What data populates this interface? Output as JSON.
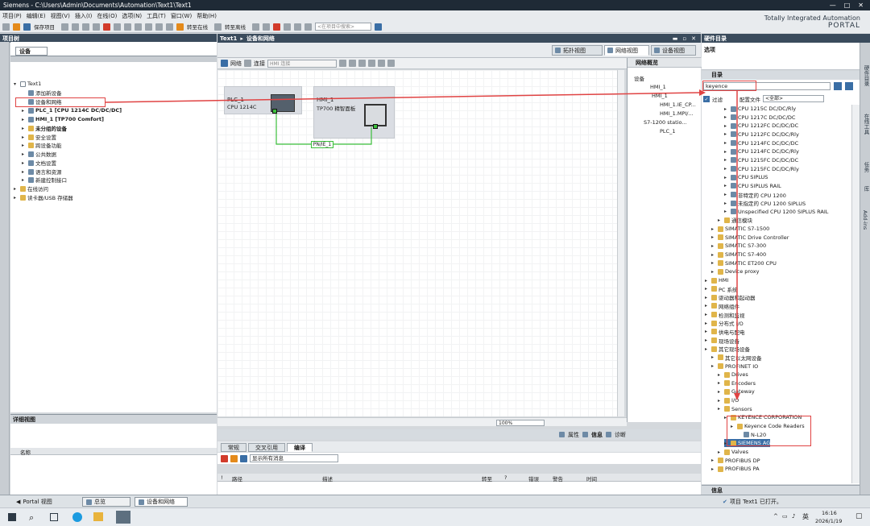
{
  "window": {
    "title": "Siemens - C:\\Users\\Admin\\Documents\\Automation\\Text1\\Text1",
    "controls": [
      "—",
      "□",
      "✕"
    ]
  },
  "menu": [
    "项目(P)",
    "编辑(E)",
    "视图(V)",
    "插入(I)",
    "在线(O)",
    "选项(N)",
    "工具(T)",
    "窗口(W)",
    "帮助(H)"
  ],
  "toolbar": {
    "save_project": "保存项目",
    "go_online": "转至在线",
    "go_offline": "转至离线",
    "search_placeholder": "<在项目中搜索>"
  },
  "brand": {
    "line1": "Totally Integrated Automation",
    "line2": "PORTAL"
  },
  "project_tree": {
    "header": "项目树",
    "devices_tab": "设备",
    "items": [
      {
        "label": "Text1",
        "level": 0,
        "bold": false
      },
      {
        "label": "添加新设备",
        "level": 1,
        "bold": false
      },
      {
        "label": "设备和网络",
        "level": 1,
        "bold": false
      },
      {
        "label": "PLC_1 [CPU 1214C DC/DC/DC]",
        "level": 1,
        "bold": true
      },
      {
        "label": "HMI_1 [TP700 Comfort]",
        "level": 1,
        "bold": true
      },
      {
        "label": "未分组的设备",
        "level": 1,
        "bold": true
      },
      {
        "label": "安全设置",
        "level": 1,
        "bold": false
      },
      {
        "label": "跨设备功能",
        "level": 1,
        "bold": false
      },
      {
        "label": "公共数据",
        "level": 1,
        "bold": false
      },
      {
        "label": "文档设置",
        "level": 1,
        "bold": false
      },
      {
        "label": "语言和资源",
        "level": 1,
        "bold": false
      },
      {
        "label": "新建控制接口",
        "level": 1,
        "bold": false
      },
      {
        "label": "在线访问",
        "level": 0,
        "bold": false
      },
      {
        "label": "读卡器/USB 存储器",
        "level": 0,
        "bold": false
      }
    ]
  },
  "detail_view": {
    "header": "详细视图",
    "col_name": "名称"
  },
  "editor": {
    "breadcrumb": [
      "Text1",
      "设备和网络"
    ],
    "view_tabs": [
      "拓扑视图",
      "网络视图",
      "设备视图"
    ],
    "net_toolbar": {
      "network": "网络",
      "connect": "连接",
      "hmi_conn": "HMI 连接"
    },
    "devices": [
      {
        "name": "PLC_1",
        "type": "CPU 1214C"
      },
      {
        "name": "HMI_1",
        "type": "TP700 精智面板"
      }
    ],
    "network_label": "PN/IE_1",
    "zoom": "100%"
  },
  "overview": {
    "title": "网络概览",
    "rows": [
      "设备",
      "HMI_1",
      "HMI_1",
      "HMI_1.IE_CP...",
      "HMI_1.MPI/...",
      "S7-1200 statio...",
      "PLC_1"
    ]
  },
  "inspector": {
    "props": "属性",
    "info": "信息",
    "diag": "诊断"
  },
  "messages": {
    "tabs": [
      "常规",
      "交叉引用",
      "编译"
    ],
    "filter": "显示所有消息",
    "columns": [
      "!",
      "路径",
      "描述",
      "转至",
      "?",
      "错误",
      "警告",
      "时间"
    ]
  },
  "hw_catalog": {
    "header": "硬件目录",
    "options": "选项",
    "catalog": "目录",
    "search_value": "keyence",
    "filter_label": "过滤",
    "profile_label": "配置文件",
    "profile_value": "<全部>",
    "tree": [
      {
        "label": "CPU 1215C DC/DC/Rly",
        "level": 3
      },
      {
        "label": "CPU 1217C DC/DC/DC",
        "level": 3
      },
      {
        "label": "CPU 1212FC DC/DC/DC",
        "level": 3
      },
      {
        "label": "CPU 1212FC DC/DC/Rly",
        "level": 3
      },
      {
        "label": "CPU 1214FC DC/DC/DC",
        "level": 3
      },
      {
        "label": "CPU 1214FC DC/DC/Rly",
        "level": 3
      },
      {
        "label": "CPU 1215FC DC/DC/DC",
        "level": 3
      },
      {
        "label": "CPU 1215FC DC/DC/Rly",
        "level": 3
      },
      {
        "label": "CPU SIPLUS",
        "level": 3
      },
      {
        "label": "CPU SIPLUS RAIL",
        "level": 3
      },
      {
        "label": "非特定的 CPU 1200",
        "level": 3
      },
      {
        "label": "未指定的 CPU 1200 SIPLUS",
        "level": 3
      },
      {
        "label": "Unspecified CPU 1200 SIPLUS RAIL",
        "level": 3
      },
      {
        "label": "通信模块",
        "level": 2
      },
      {
        "label": "SIMATIC S7-1500",
        "level": 1
      },
      {
        "label": "SIMATIC Drive Controller",
        "level": 1
      },
      {
        "label": "SIMATIC S7-300",
        "level": 1
      },
      {
        "label": "SIMATIC S7-400",
        "level": 1
      },
      {
        "label": "SIMATIC ET200 CPU",
        "level": 1
      },
      {
        "label": "Device proxy",
        "level": 1
      },
      {
        "label": "HMI",
        "level": 0
      },
      {
        "label": "PC 系统",
        "level": 0
      },
      {
        "label": "驱动器和起动器",
        "level": 0
      },
      {
        "label": "网络组件",
        "level": 0
      },
      {
        "label": "检测和监视",
        "level": 0
      },
      {
        "label": "分布式 I/O",
        "level": 0
      },
      {
        "label": "供电与配电",
        "level": 0
      },
      {
        "label": "现场设备",
        "level": 0
      },
      {
        "label": "其它现场设备",
        "level": 0
      },
      {
        "label": "其它以太网设备",
        "level": 1
      },
      {
        "label": "PROFINET IO",
        "level": 1
      },
      {
        "label": "Drives",
        "level": 2
      },
      {
        "label": "Encoders",
        "level": 2
      },
      {
        "label": "Gateway",
        "level": 2
      },
      {
        "label": "I/O",
        "level": 2
      },
      {
        "label": "Sensors",
        "level": 2
      },
      {
        "label": "KEYENCE CORPORATION",
        "level": 3
      },
      {
        "label": "Keyence Code Readers",
        "level": 4
      },
      {
        "label": "N-L20",
        "level": 5
      },
      {
        "label": "SIEMENS AG",
        "level": 3
      },
      {
        "label": "Valves",
        "level": 2
      },
      {
        "label": "PROFIBUS DP",
        "level": 1
      },
      {
        "label": "PROFIBUS PA",
        "level": 1
      }
    ],
    "info_header": "信息"
  },
  "right_tabs": [
    "硬件目录",
    "在线工具",
    "任务",
    "库",
    "Add-ins"
  ],
  "portal_bar": {
    "portal_view": "Portal 视图",
    "tasks": [
      "总览",
      "设备和网络"
    ],
    "status": "项目 Text1 已打开。"
  },
  "taskbar": {
    "time": "16:16",
    "date": "2026/1/19",
    "lang": "英"
  },
  "colors": {
    "accent": "#3a4b5c",
    "highlight": "#e04343",
    "network": "#3bbf3b"
  }
}
